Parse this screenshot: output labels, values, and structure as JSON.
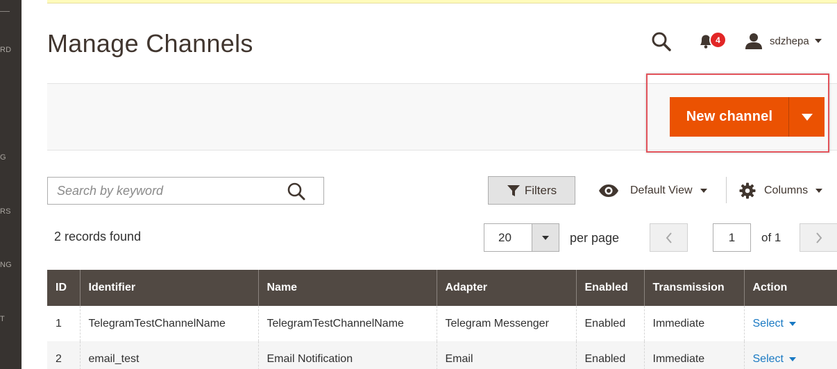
{
  "sidebar": {
    "items": [
      {
        "label": "RD",
        "name": "sidebar-item-dashboard"
      },
      {
        "label": "G",
        "name": "sidebar-item-catalog"
      },
      {
        "label": "RS",
        "name": "sidebar-item-customers"
      },
      {
        "label": "NG",
        "name": "sidebar-item-marketing"
      },
      {
        "label": "T",
        "name": "sidebar-item-content"
      }
    ]
  },
  "header": {
    "title": "Manage Channels",
    "notifications_count": "4",
    "username": "sdzhepa"
  },
  "actions": {
    "new_channel_label": "New channel"
  },
  "toolbar": {
    "search_placeholder": "Search by keyword",
    "filters_label": "Filters",
    "view_label": "Default View",
    "columns_label": "Columns",
    "records_found": "2 records found",
    "per_page_value": "20",
    "per_page_label": "per page",
    "current_page": "1",
    "page_total": "of 1"
  },
  "grid": {
    "columns": [
      "ID",
      "Identifier",
      "Name",
      "Adapter",
      "Enabled",
      "Transmission",
      "Action"
    ],
    "rows": [
      {
        "id": "1",
        "identifier": "TelegramTestChannelName",
        "name": "TelegramTestChannelName",
        "adapter": "Telegram Messenger",
        "enabled": "Enabled",
        "transmission": "Immediate",
        "action": "Select"
      },
      {
        "id": "2",
        "identifier": "email_test",
        "name": "Email Notification",
        "adapter": "Email",
        "enabled": "Enabled",
        "transmission": "Immediate",
        "action": "Select"
      }
    ]
  },
  "colors": {
    "accent": "#eb5202",
    "grid_header": "#514943",
    "link": "#1979c3",
    "badge": "#e22626",
    "highlight_outline": "#e2535b"
  }
}
